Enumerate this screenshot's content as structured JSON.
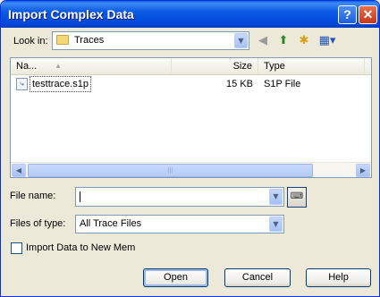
{
  "window": {
    "title": "Import Complex Data"
  },
  "look_in": {
    "label": "Look in:",
    "value": "Traces"
  },
  "toolbar": {
    "icons": [
      "back-icon",
      "up-folder-icon",
      "new-folder-icon",
      "view-menu-icon"
    ]
  },
  "file_list": {
    "columns": [
      "Na...",
      "Size",
      "Type"
    ],
    "rows": [
      {
        "name": "testtrace.s1p",
        "size": "15 KB",
        "type": "S1P File"
      }
    ]
  },
  "file_name": {
    "label": "File name:",
    "value": ""
  },
  "files_of_type": {
    "label": "Files of type:",
    "value": "All Trace Files"
  },
  "import_checkbox": {
    "label": "Import Data to New Mem",
    "checked": false
  },
  "buttons": {
    "open": "Open",
    "cancel": "Cancel",
    "help": "Help"
  }
}
